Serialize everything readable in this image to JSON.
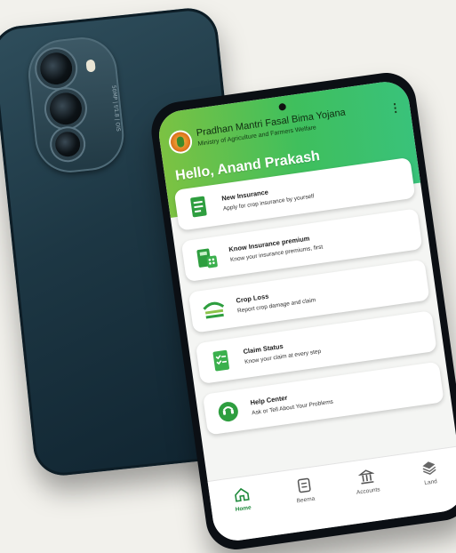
{
  "app": {
    "title": "Pradhan Mantri Fasal Bima Yojana",
    "subtitle": "Ministry of Agriculture and Farmers Welfare",
    "greeting": "Hello, Anand Prakash",
    "menu_icon": "more-vertical-icon"
  },
  "back_phone": {
    "camera_text": "50MP | f/1.8 | OIS"
  },
  "cards": [
    {
      "title": "New Insurance",
      "description": "Apply for crop insurance by yourself",
      "icon": "document-list-icon"
    },
    {
      "title": "Know Insurance premium",
      "description": "Know your insurance premiums, first",
      "icon": "calculator-icon"
    },
    {
      "title": "Crop Loss",
      "description": "Report crop damage and claim",
      "icon": "crop-loss-icon"
    },
    {
      "title": "Claim Status",
      "description": "Know your claim at every step",
      "icon": "checklist-icon"
    },
    {
      "title": "Help Center",
      "description": "Ask or Tell About Your Problems",
      "icon": "support-icon"
    }
  ],
  "nav": [
    {
      "label": "Home",
      "icon": "home-icon",
      "active": true
    },
    {
      "label": "Beema",
      "icon": "document-icon",
      "active": false
    },
    {
      "label": "Accounts",
      "icon": "bank-icon",
      "active": false
    },
    {
      "label": "Land",
      "icon": "layers-icon",
      "active": false
    }
  ],
  "colors": {
    "header_start": "#7cc242",
    "header_end": "#39c27a",
    "accent": "#1f8a3c",
    "phone_back": "#1d3744"
  }
}
